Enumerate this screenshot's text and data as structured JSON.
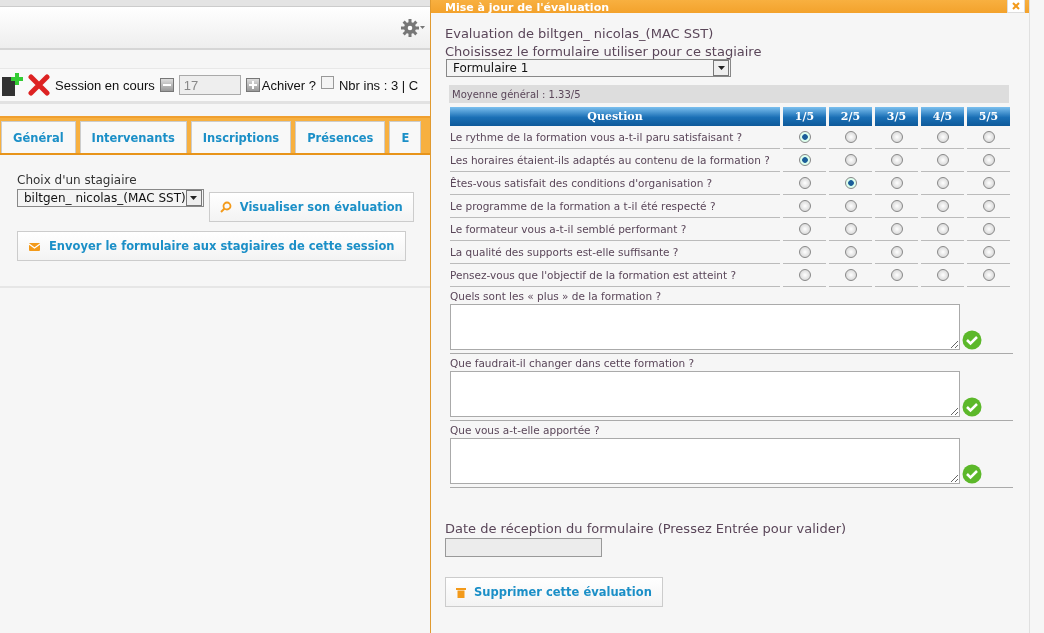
{
  "page": {
    "toolbar": {
      "session_label": "Session en cours",
      "session_value": "17",
      "archive_label": "Achiver ?",
      "archive_checked": false,
      "count": "Nbr ins : 3 | C"
    },
    "tabs": [
      {
        "label": "Général"
      },
      {
        "label": "Intervenants"
      },
      {
        "label": "Inscriptions"
      },
      {
        "label": "Présences"
      },
      {
        "label": "E"
      }
    ],
    "trainee": {
      "label": "Choix d'un stagiaire",
      "value": "biltgen_ nicolas_(MAC SST)",
      "view_button": "Visualiser son évaluation",
      "send_button": "Envoyer le formulaire aux stagiaires de cette session"
    }
  },
  "dialog": {
    "title": "Mise à jour de l'évaluation",
    "heading": "Evaluation de biltgen_ nicolas_(MAC SST)",
    "form_label": "Choisissez le formulaire utiliser pour ce stagiaire",
    "form_value": "Formulaire 1",
    "average": "Moyenne général : 1.33/5",
    "columns": [
      "Question",
      "1/5",
      "2/5",
      "3/5",
      "4/5",
      "5/5"
    ],
    "questions": [
      {
        "text": "Le rythme de la formation vous a-t-il paru satisfaisant ?",
        "options": [
          {
            "selected": true
          },
          {
            "selected": false
          },
          {
            "selected": false
          },
          {
            "selected": false
          },
          {
            "selected": false
          }
        ]
      },
      {
        "text": "Les horaires étaient-ils adaptés au contenu de la formation ?",
        "options": [
          {
            "selected": true
          },
          {
            "selected": false
          },
          {
            "selected": false
          },
          {
            "selected": false
          },
          {
            "selected": false
          }
        ]
      },
      {
        "text": "Êtes-vous satisfait des conditions d'organisation ?",
        "options": [
          {
            "selected": false
          },
          {
            "selected": true
          },
          {
            "selected": false
          },
          {
            "selected": false
          },
          {
            "selected": false
          }
        ]
      },
      {
        "text": "Le programme de la formation a t-il été respecté ?",
        "options": [
          {
            "selected": false
          },
          {
            "selected": false
          },
          {
            "selected": false
          },
          {
            "selected": false
          },
          {
            "selected": false
          }
        ]
      },
      {
        "text": "Le formateur vous a-t-il semblé performant ?",
        "options": [
          {
            "selected": false
          },
          {
            "selected": false
          },
          {
            "selected": false
          },
          {
            "selected": false
          },
          {
            "selected": false
          }
        ]
      },
      {
        "text": "La qualité des supports est-elle suffisante ?",
        "options": [
          {
            "selected": false
          },
          {
            "selected": false
          },
          {
            "selected": false
          },
          {
            "selected": false
          },
          {
            "selected": false
          }
        ]
      },
      {
        "text": "Pensez-vous que l'objectif de la formation est atteint ?",
        "options": [
          {
            "selected": false
          },
          {
            "selected": false
          },
          {
            "selected": false
          },
          {
            "selected": false
          },
          {
            "selected": false
          }
        ]
      }
    ],
    "open_questions": [
      {
        "label": "Quels sont les « plus » de la formation ?"
      },
      {
        "label": "Que faudrait-il changer dans cette formation ?"
      },
      {
        "label": "Que vous a-t-elle apportée ?"
      }
    ],
    "date_label": "Date de réception du formulaire (Pressez Entrée pour valider)",
    "delete_button": "Supprimer cette évaluation"
  }
}
